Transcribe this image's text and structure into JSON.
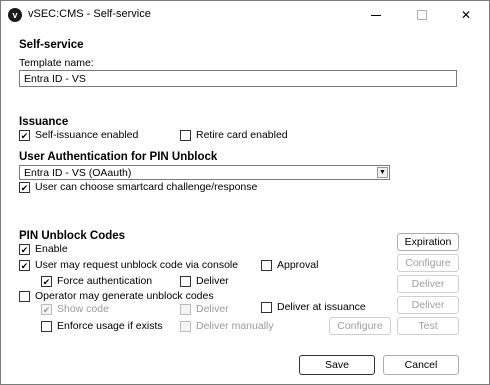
{
  "window": {
    "title": "vSEC:CMS - Self-service",
    "app_icon": "v"
  },
  "self_service": {
    "heading": "Self-service",
    "template_name_label": "Template name:",
    "template_name_value": "Entra ID - VS"
  },
  "issuance": {
    "heading": "Issuance",
    "self_issuance": {
      "label": "Self-issuance enabled",
      "checked": true
    },
    "retire_card": {
      "label": "Retire card enabled",
      "checked": false
    }
  },
  "user_auth": {
    "heading": "User Authentication for PIN Unblock",
    "select_value": "Entra ID - VS (OAauth)",
    "choose_challenge": {
      "label": "User can choose smartcard challenge/response",
      "checked": true
    }
  },
  "pin_unblock": {
    "heading": "PIN Unblock Codes",
    "enable": {
      "label": "Enable",
      "checked": true
    },
    "user_request": {
      "label": "User may request unblock code via console",
      "checked": true
    },
    "approval": {
      "label": "Approval",
      "checked": false
    },
    "force_auth": {
      "label": "Force authentication",
      "checked": true
    },
    "deliver1": {
      "label": "Deliver",
      "checked": false
    },
    "operator_generate": {
      "label": "Operator may generate unblock codes",
      "checked": false
    },
    "show_code": {
      "label": "Show code",
      "checked": true
    },
    "deliver2": {
      "label": "Deliver",
      "checked": false
    },
    "deliver_at_issuance": {
      "label": "Deliver at issuance",
      "checked": false
    },
    "enforce_usage": {
      "label": "Enforce usage if exists",
      "checked": false
    },
    "deliver_manually": {
      "label": "Deliver manually",
      "checked": false
    }
  },
  "buttons": {
    "expiration": "Expiration",
    "configure1": "Configure",
    "deliver1": "Deliver",
    "deliver2": "Deliver",
    "configure2": "Configure",
    "test": "Test",
    "save": "Save",
    "cancel": "Cancel"
  },
  "colors": {
    "border": "#7a7a7a",
    "disabled_text": "#9a9a9a"
  }
}
